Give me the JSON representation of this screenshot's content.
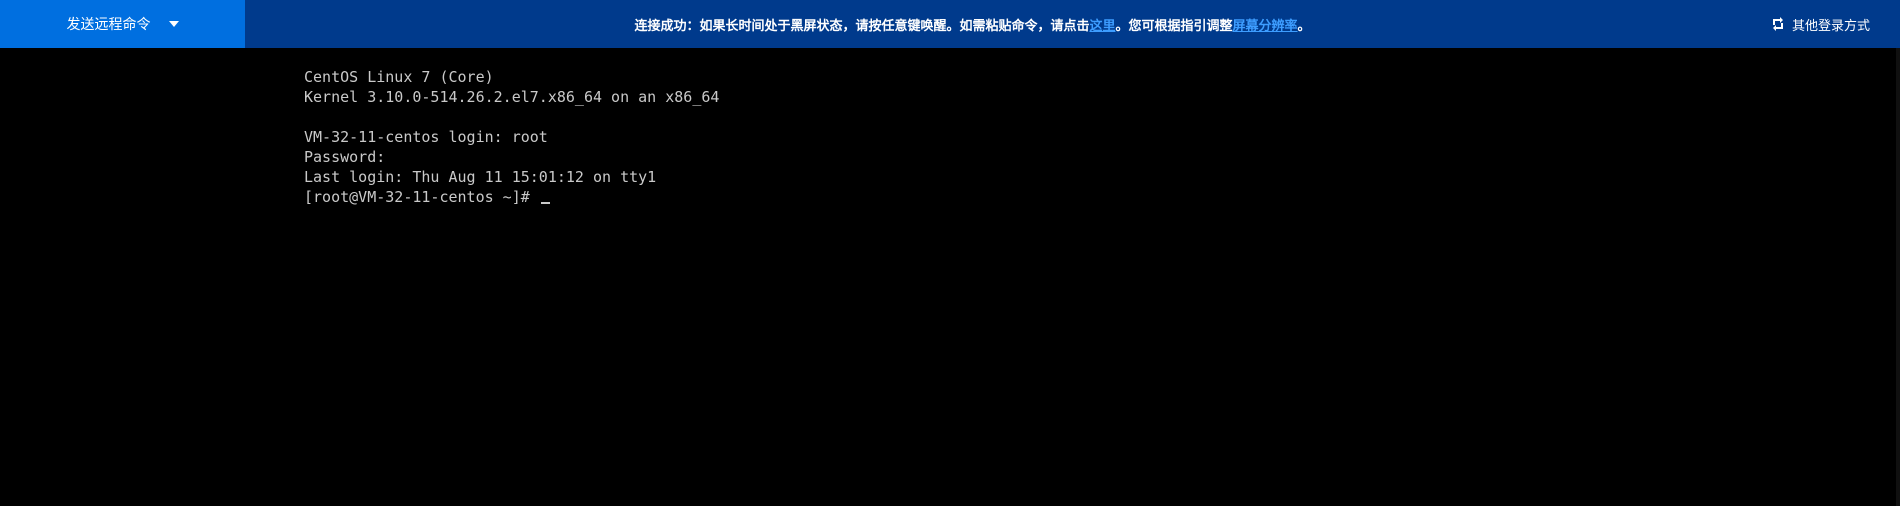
{
  "topbar": {
    "send_command_label": "发送远程命令",
    "notice": {
      "part1": "连接成功：如果长时间处于黑屏状态，请按任意键唤醒。如需粘贴命令，请点击",
      "link1": "这里",
      "part2": "。您可根据指引调整",
      "link2": "屏幕分辨率",
      "part3": "。"
    },
    "other_login_label": "其他登录方式"
  },
  "terminal": {
    "lines": [
      "CentOS Linux 7 (Core)",
      "Kernel 3.10.0-514.26.2.el7.x86_64 on an x86_64",
      "",
      "VM-32-11-centos login: root",
      "Password:",
      "Last login: Thu Aug 11 15:01:12 on tty1"
    ],
    "prompt": "[root@VM-32-11-centos ~]# "
  },
  "colors": {
    "topbar_bg": "#003a8c",
    "send_button_bg": "#006fe0",
    "link": "#3d9dff",
    "terminal_bg": "#000000",
    "terminal_text": "#c9c9c9"
  },
  "icons": {
    "dropdown": "caret-down-icon",
    "switch_login": "switch-icon"
  }
}
